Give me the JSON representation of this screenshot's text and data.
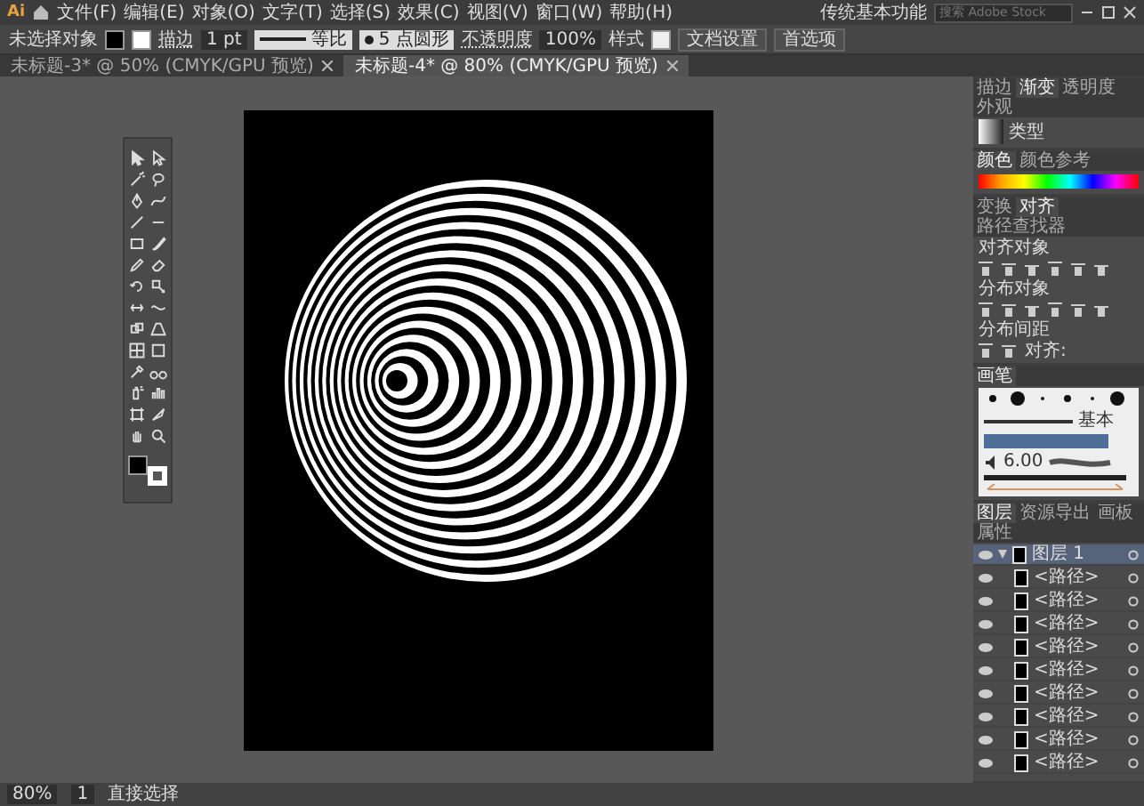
{
  "menu_bar": {
    "logo": "Ai",
    "items": [
      "文件(F)",
      "编辑(E)",
      "对象(O)",
      "文字(T)",
      "选择(S)",
      "效果(C)",
      "视图(V)",
      "窗口(W)",
      "帮助(H)"
    ],
    "workspace": "传统基本功能",
    "search": {
      "placeholder": "搜索 Adobe Stock"
    }
  },
  "control_bar": {
    "selection": "未选择对象",
    "stroke_label": "描边",
    "stroke_weight": "1 pt",
    "profile": "等比",
    "brush": "5 点圆形",
    "opacity_label": "不透明度",
    "opacity": "100%",
    "style_label": "样式",
    "buttons": [
      "文档设置",
      "首选项"
    ]
  },
  "doc_tabs": [
    {
      "label": "未标题-3* @ 50% (CMYK/GPU 预览)",
      "selected": false
    },
    {
      "label": "未标题-4* @ 80% (CMYK/GPU 预览)",
      "selected": true
    }
  ],
  "stroke_panel": {
    "tabs": [
      {
        "label": "描边",
        "selected": false
      },
      {
        "label": "渐变",
        "selected": true
      },
      {
        "label": "透明度",
        "selected": false
      },
      {
        "label": "外观",
        "selected": false
      }
    ],
    "type_label": "类型"
  },
  "color_panel": {
    "tabs": [
      {
        "label": "颜色",
        "selected": true
      },
      {
        "label": "颜色参考",
        "selected": false
      }
    ]
  },
  "align_panel": {
    "tabs": [
      {
        "label": "变换",
        "selected": false
      },
      {
        "label": "对齐",
        "selected": true
      },
      {
        "label": "路径查找器",
        "selected": false
      }
    ],
    "sections": [
      "对齐对象",
      "分布对象",
      "分布间距"
    ],
    "align_to": "对齐:"
  },
  "brushes_panel": {
    "title": "画笔",
    "basic": "基本",
    "size": "6.00"
  },
  "layers_panel": {
    "tabs": [
      {
        "label": "图层",
        "selected": true
      },
      {
        "label": "资源导出",
        "selected": false
      },
      {
        "label": "画板",
        "selected": false
      },
      {
        "label": "属性",
        "selected": false
      }
    ],
    "layer": "图层 1",
    "paths": [
      "<路径>",
      "<路径>",
      "<路径>",
      "<路径>",
      "<路径>",
      "<路径>",
      "<路径>",
      "<路径>",
      "<路径>"
    ]
  },
  "status_bar": {
    "zoom": "80%",
    "artboard": "1",
    "tool": "直接选择"
  }
}
